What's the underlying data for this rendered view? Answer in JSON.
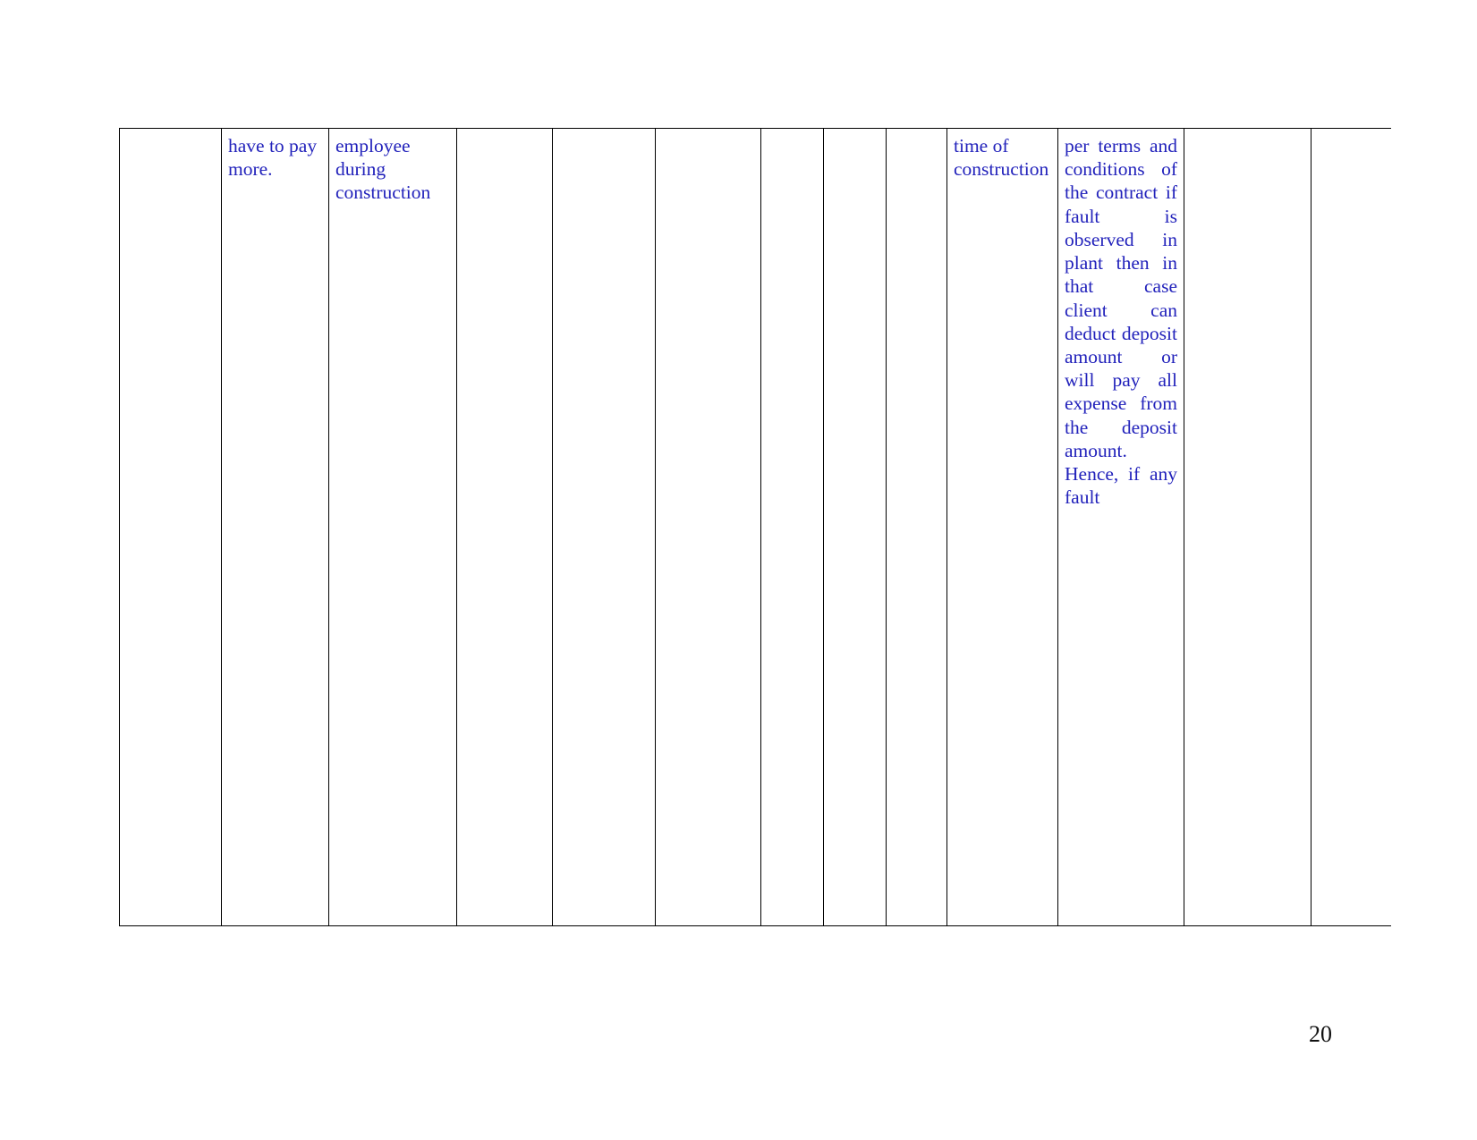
{
  "document": {
    "page_number": "20",
    "text_color": "#2222bb",
    "border_color": "#000000",
    "background": "#ffffff"
  },
  "table": {
    "column_count": 14,
    "row_count": 1,
    "cells": {
      "col1": "",
      "col2": "have to pay more.",
      "col3": "employee during construction",
      "col4": "",
      "col5": "",
      "col6": "",
      "col7": "",
      "col8": "",
      "col9": "",
      "col10": "time of construction",
      "col11": "per terms and conditions of the contract if fault is observed in plant then in that case client can deduct deposit amount or will pay all expense from the deposit amount. Hence, if any fault",
      "col12": "",
      "col13": "",
      "col14": ""
    }
  }
}
